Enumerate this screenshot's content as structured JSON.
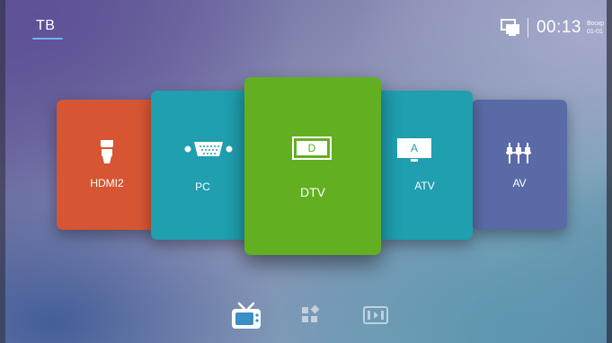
{
  "header": {
    "title": "ТВ",
    "time": "00:13",
    "day": "Воскр",
    "date": "01-01",
    "network_icon": "network-icon"
  },
  "sources": [
    {
      "id": "hdmi2",
      "label": "HDMI2",
      "icon": "hdmi-icon",
      "color": "#d65533"
    },
    {
      "id": "pc",
      "label": "PC",
      "icon": "vga-icon",
      "color": "#1f9fb0"
    },
    {
      "id": "dtv",
      "label": "DTV",
      "badge": "D",
      "icon": "tv-screen-icon",
      "color": "#62b021",
      "selected": true
    },
    {
      "id": "atv",
      "label": "ATV",
      "badge": "A",
      "icon": "tv-screen-icon",
      "color": "#1f9fb0"
    },
    {
      "id": "av",
      "label": "AV",
      "icon": "av-cable-icon",
      "color": "#5a6aa6"
    }
  ],
  "bottom_nav": [
    {
      "id": "tv",
      "icon": "tv-icon",
      "active": true
    },
    {
      "id": "apps",
      "icon": "apps-icon",
      "active": false
    },
    {
      "id": "media",
      "icon": "media-icon",
      "active": false
    }
  ]
}
